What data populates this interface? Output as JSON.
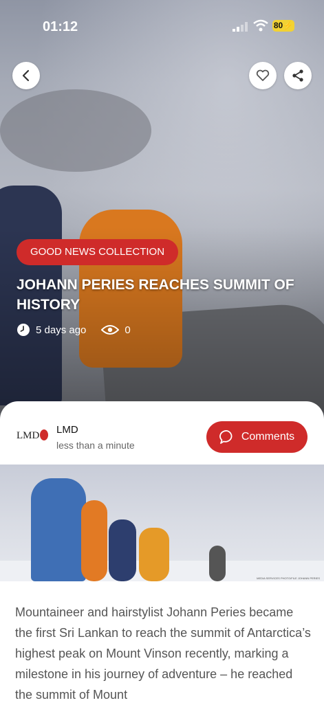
{
  "status_bar": {
    "time": "01:12",
    "battery": "80"
  },
  "article": {
    "category": "GOOD NEWS COLLECTION",
    "title": "JOHANN PERIES REACHES SUMMIT OF HISTORY",
    "posted": "5 days ago",
    "views": "0"
  },
  "author": {
    "logo_text": "LMD",
    "name": "LMD",
    "read_time": "less than a minute"
  },
  "actions": {
    "comments_label": "Comments"
  },
  "photo": {
    "credit": "MEDIA SERVICES PHOTO/FILE JOHANN PERIES"
  },
  "body": {
    "paragraph": "Mountaineer and hairstylist Johann Peries became the first Sri Lankan to reach the summit of Antarctica’s highest peak on Mount Vinson recently, marking a milestone in his journey of adventure – he reached the summit of Mount"
  },
  "colors": {
    "accent": "#cf2b2a",
    "battery": "#f2d233"
  }
}
